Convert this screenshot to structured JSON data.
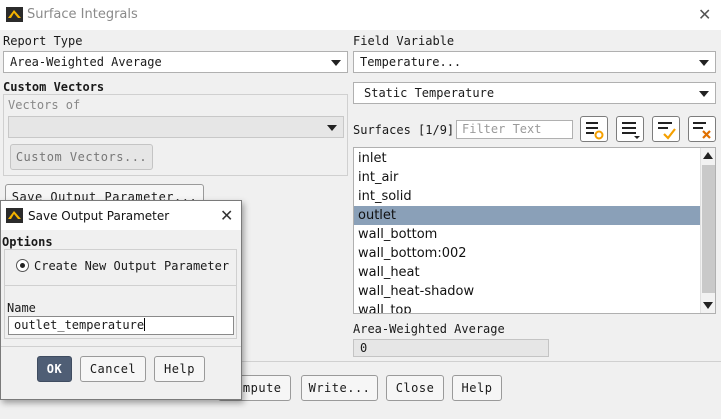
{
  "window": {
    "title": "Surface Integrals",
    "app_icon": "ansys-logo-icon",
    "close_icon": "close-icon"
  },
  "report_type": {
    "label": "Report Type",
    "value": "Area-Weighted Average"
  },
  "custom_vectors": {
    "heading": "Custom Vectors",
    "vectors_of_label": "Vectors of",
    "vectors_of_value": "",
    "button_label": "Custom Vectors..."
  },
  "save_output_param_button": "Save Output Parameter...",
  "field_variable": {
    "label": "Field Variable",
    "category": "Temperature...",
    "quantity": "Static Temperature"
  },
  "surfaces": {
    "label": "Surfaces [1/9]",
    "filter_placeholder": "Filter Text",
    "toolbar_icons": [
      "select-all-icon",
      "list-options-icon",
      "check-all-icon",
      "deselect-all-icon"
    ],
    "items": [
      {
        "label": "inlet",
        "selected": false
      },
      {
        "label": "int_air",
        "selected": false
      },
      {
        "label": "int_solid",
        "selected": false
      },
      {
        "label": "outlet",
        "selected": true
      },
      {
        "label": "wall_bottom",
        "selected": false
      },
      {
        "label": "wall_bottom:002",
        "selected": false
      },
      {
        "label": "wall_heat",
        "selected": false
      },
      {
        "label": "wall_heat-shadow",
        "selected": false
      },
      {
        "label": "wall_top",
        "selected": false
      }
    ]
  },
  "result": {
    "label": "Area-Weighted Average",
    "value": "0"
  },
  "bottom_buttons": {
    "compute": "Compute",
    "write": "Write...",
    "close": "Close",
    "help": "Help"
  },
  "dialog": {
    "title": "Save Output Parameter",
    "options_heading": "Options",
    "radio_label": "Create New Output Parameter",
    "name_label": "Name",
    "name_value": "outlet_temperature",
    "ok": "OK",
    "cancel": "Cancel",
    "help": "Help"
  },
  "colors": {
    "selection": "#8aa0b8",
    "ok_button": "#4f5e75",
    "window_bg": "#f0f0f0"
  }
}
